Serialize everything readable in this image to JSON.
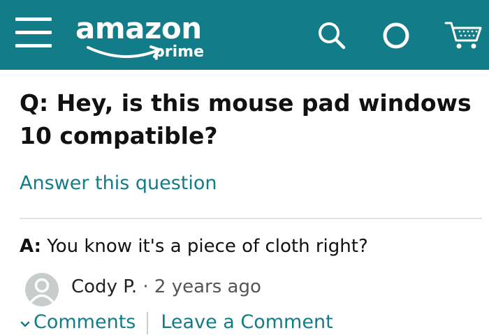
{
  "header": {
    "menu_icon": "hamburger-menu-icon",
    "logo_word": "amazon",
    "logo_sub": "prime",
    "search_icon": "search-icon",
    "alexa_icon": "alexa-icon",
    "cart_icon": "cart-icon",
    "bar_color": "#127c89"
  },
  "qa": {
    "question": "Q: Hey, is this mouse pad windows 10 compatible?",
    "answer_link": "Answer this question",
    "answer_prefix": "A:",
    "answer_text": " You know it's a piece of cloth right?",
    "author": "Cody P.",
    "separator": "·",
    "time": "2 years ago",
    "comments_label": "Comments",
    "leave_comment_label": "Leave a Comment",
    "link_color": "#127c89"
  }
}
